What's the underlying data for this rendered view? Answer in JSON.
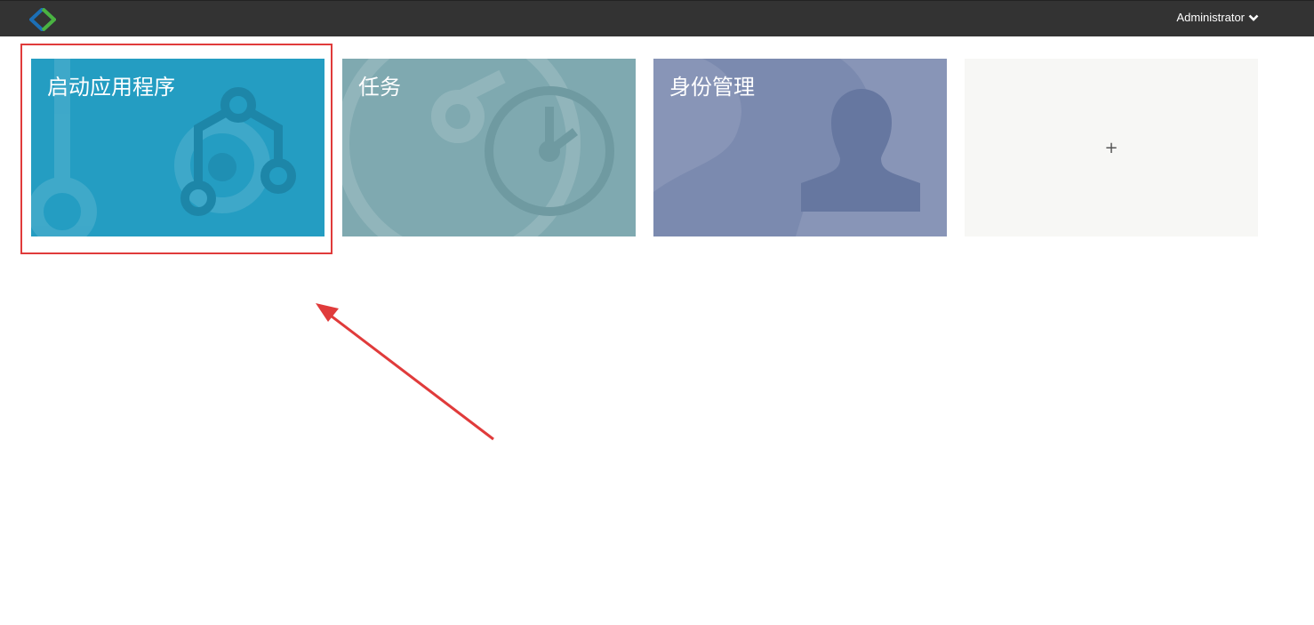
{
  "header": {
    "user_label": "Administrator",
    "logo_icon": "diamond-logo-icon",
    "dropdown_icon": "chevron-down-icon"
  },
  "tiles": [
    {
      "label": "启动应用程序",
      "icon": "workflow-icon",
      "color": "#249dc2"
    },
    {
      "label": "任务",
      "icon": "clock-icon",
      "color": "#7fa9b0"
    },
    {
      "label": "身份管理",
      "icon": "user-silhouette-icon",
      "color": "#7b8aaf"
    },
    {
      "label": "+",
      "icon": "plus-icon",
      "color": "#f7f7f5"
    }
  ],
  "annotation": {
    "highlight_color": "#e03b3b"
  }
}
